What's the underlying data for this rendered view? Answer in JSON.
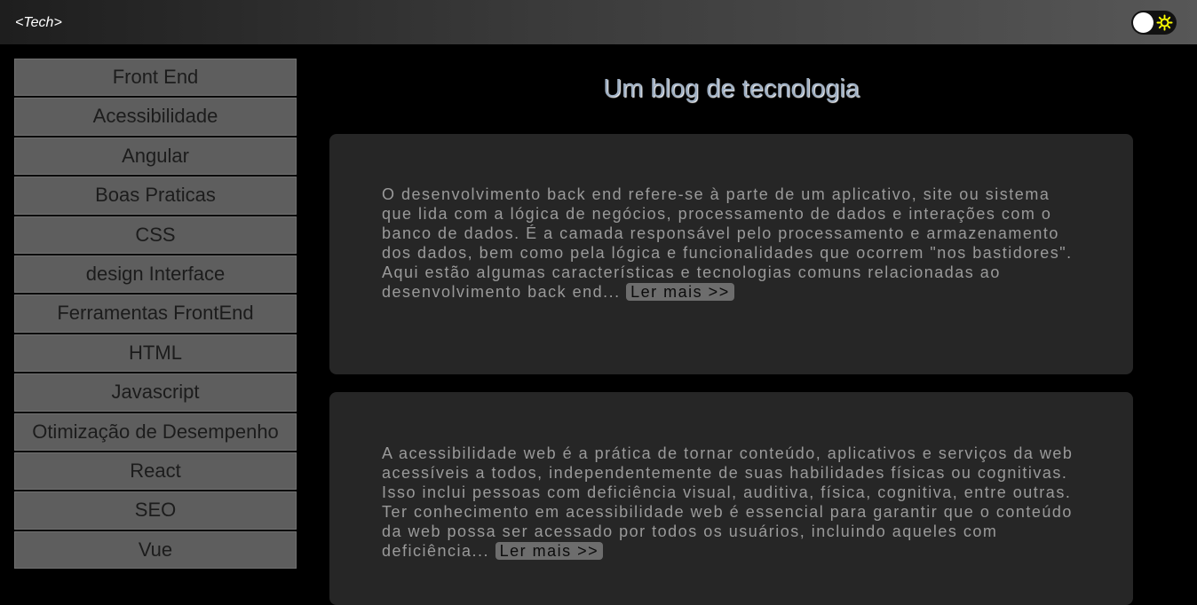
{
  "header": {
    "logo_text": "<Tech>",
    "theme_toggle": {
      "icon": "sun-icon",
      "knob_color": "#ffffff",
      "icon_color": "#ffff00"
    }
  },
  "sidebar": {
    "items": [
      {
        "label": "Front End"
      },
      {
        "label": "Acessibilidade"
      },
      {
        "label": "Angular"
      },
      {
        "label": "Boas Praticas"
      },
      {
        "label": "CSS"
      },
      {
        "label": "design Interface"
      },
      {
        "label": "Ferramentas FrontEnd"
      },
      {
        "label": "HTML"
      },
      {
        "label": "Javascript"
      },
      {
        "label": "Otimização de Desempenho"
      },
      {
        "label": "React"
      },
      {
        "label": "SEO"
      },
      {
        "label": "Vue"
      }
    ]
  },
  "main": {
    "title": "Um blog de tecnologia",
    "posts": [
      {
        "excerpt": "O desenvolvimento back end refere-se à parte de um aplicativo, site ou sistema que lida com a lógica de negócios, processamento de dados e interações com o banco de dados. É a camada responsável pelo processamento e armazenamento dos dados, bem como pela lógica e funcionalidades que ocorrem \"nos bastidores\". Aqui estão algumas características e tecnologias comuns relacionadas ao desenvolvimento back end...",
        "read_more": "Ler mais >>"
      },
      {
        "excerpt": "A acessibilidade web é a prática de tornar conteúdo, aplicativos e serviços da web acessíveis a todos, independentemente de suas habilidades físicas ou cognitivas. Isso inclui pessoas com deficiência visual, auditiva, física, cognitiva, entre outras. Ter conhecimento em acessibilidade web é essencial para garantir que o conteúdo da web possa ser acessado por todos os usuários, incluindo aqueles com deficiência...",
        "read_more": "Ler mais >>"
      }
    ]
  }
}
